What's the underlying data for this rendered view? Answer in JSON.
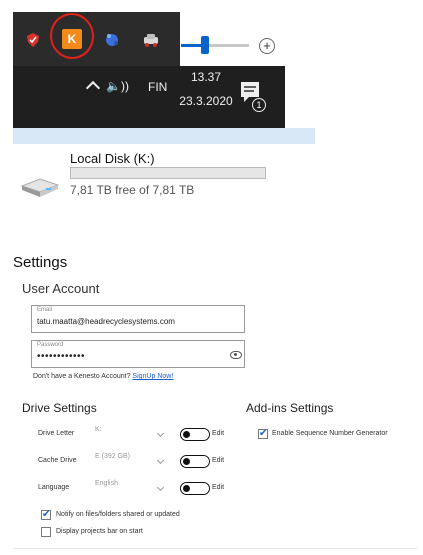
{
  "taskbar": {
    "language": "FIN",
    "time": "13.37",
    "date": "23.3.2020",
    "notification_count": "1",
    "tray_icons": [
      "shield-red-icon",
      "kenesto-k-icon",
      "blue-app-icon",
      "car-icon"
    ],
    "k_icon_letter": "K",
    "plus_symbol": "+",
    "speaker_symbol": "🔈))",
    "volume_percent": 35,
    "accent_color": "#0a63c9",
    "k_icon_color": "#f28a1c",
    "annotation_color": "#e0201c"
  },
  "drive": {
    "name": "Local Disk (K:)",
    "free_text": "7,81 TB free of 7,81 TB",
    "used_fraction": 0.0
  },
  "settings": {
    "title": "Settings",
    "user_account": {
      "heading": "User Account",
      "email_label": "Email",
      "email_value": "tatu.maatta@headrecyclesystems.com",
      "password_label": "Password",
      "password_value": "••••••••••••",
      "no_account_text": "Don't have a Kenesto Account?",
      "signup_link": "SignUp Now!"
    },
    "drive_settings": {
      "heading": "Drive Settings",
      "rows": [
        {
          "label": "Drive Letter",
          "value": "K:",
          "edit_label": "Edit"
        },
        {
          "label": "Cache Drive",
          "value": "E (392 GB)",
          "edit_label": "Edit"
        },
        {
          "label": "Language",
          "value": "English",
          "edit_label": "Edit"
        }
      ],
      "checkboxes": [
        {
          "label": "Notify on files/folders shared or updated",
          "checked": true
        },
        {
          "label": "Display projects bar on start",
          "checked": false
        }
      ]
    },
    "addins": {
      "heading": "Add-ins Settings",
      "checkboxes": [
        {
          "label": "Enable Sequence Number Generator",
          "checked": true
        }
      ]
    }
  },
  "check_mark": "✔"
}
